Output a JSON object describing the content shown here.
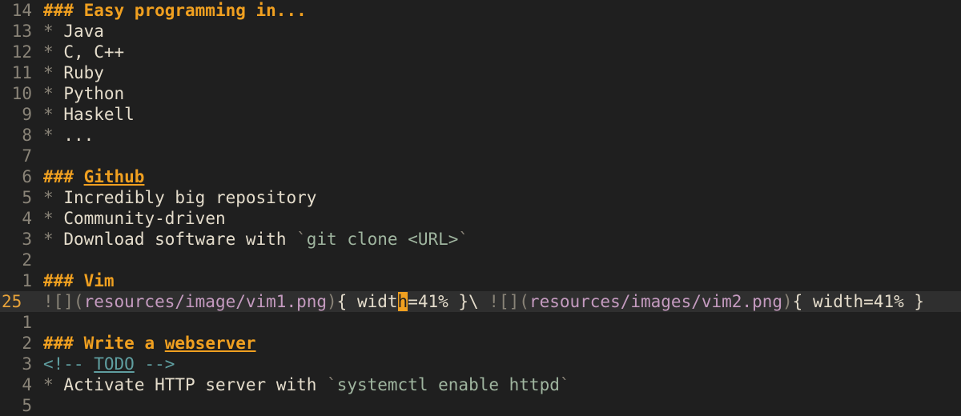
{
  "lines": [
    {
      "num": "14",
      "heading_mark": "###",
      "heading_text": "Easy programming in..."
    },
    {
      "num": "13",
      "bullet": "*",
      "text": "Java"
    },
    {
      "num": "12",
      "bullet": "*",
      "text": "C, C++"
    },
    {
      "num": "11",
      "bullet": "*",
      "text": "Ruby"
    },
    {
      "num": "10",
      "bullet": "*",
      "text": "Python"
    },
    {
      "num": "9",
      "bullet": "*",
      "text": "Haskell"
    },
    {
      "num": "8",
      "bullet": "*",
      "text": "..."
    },
    {
      "num": "7"
    },
    {
      "num": "6",
      "heading_mark": "###",
      "heading_link": "Github"
    },
    {
      "num": "5",
      "bullet": "*",
      "text": "Incredibly big repository"
    },
    {
      "num": "4",
      "bullet": "*",
      "text": "Community-driven"
    },
    {
      "num": "3",
      "bullet": "*",
      "text": "Download software with ",
      "tick_open": "`",
      "code": "git clone <URL>",
      "tick_close": "`"
    },
    {
      "num": "2"
    },
    {
      "num": "1",
      "heading_mark": "###",
      "heading_text": "Vim"
    },
    {
      "num": "25",
      "img1_prefix": "![](",
      "img1_path": "resources/image/vim1.png",
      "img1_close": ")",
      "attr1_open": "{ widt",
      "cursor_char": "h",
      "attr1_rest": "=41% }",
      "sep": "\\ ",
      "img2_prefix": "![](",
      "img2_path": "resources/images/vim2.png",
      "img2_close": ")",
      "attr2": "{ width=41% }"
    },
    {
      "num": "1"
    },
    {
      "num": "2",
      "heading_mark": "###",
      "heading_text": "Write a ",
      "heading_link": "webserver"
    },
    {
      "num": "3",
      "comment_open": "<!-- ",
      "todo": "TODO",
      "comment_close": " -->"
    },
    {
      "num": "4",
      "bullet": "*",
      "text": "Activate HTTP server with ",
      "tick_open": "`",
      "code": "systemctl enable httpd",
      "tick_close": "`"
    },
    {
      "num": "5"
    }
  ]
}
